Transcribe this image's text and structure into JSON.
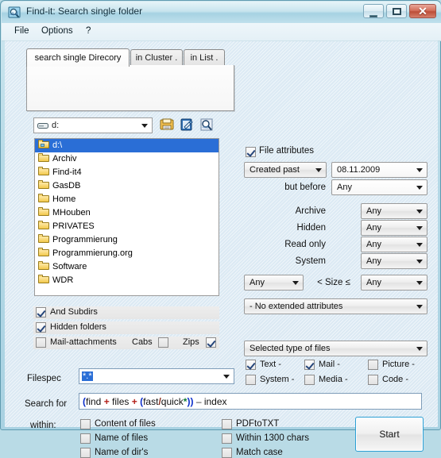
{
  "window": {
    "title": "Find-it: Search single folder",
    "icon": "app-icon",
    "buttons": {
      "minimize": "—",
      "maximize": "□",
      "close": "✕"
    }
  },
  "menu": {
    "file": "File",
    "options": "Options",
    "help": "?"
  },
  "tabs": [
    {
      "label": "search single Direcory",
      "active": true
    },
    {
      "label": "in Cluster .",
      "active": false
    },
    {
      "label": "in List .",
      "active": false
    }
  ],
  "drive": {
    "value": "d:",
    "icon": "drive-icon"
  },
  "toolbar": {
    "save": "save-icon",
    "edit": "edit-icon",
    "find": "find-icon"
  },
  "tree": {
    "items": [
      {
        "label": "d:\\",
        "selected": true,
        "open": true
      },
      {
        "label": "Archiv",
        "selected": false,
        "open": false
      },
      {
        "label": "Find-it4",
        "selected": false,
        "open": false
      },
      {
        "label": "GasDB",
        "selected": false,
        "open": false
      },
      {
        "label": "Home",
        "selected": false,
        "open": false
      },
      {
        "label": "MHouben",
        "selected": false,
        "open": false
      },
      {
        "label": "PRIVATES",
        "selected": false,
        "open": false
      },
      {
        "label": "Programmierung",
        "selected": false,
        "open": false
      },
      {
        "label": "Programmierung.org",
        "selected": false,
        "open": false
      },
      {
        "label": "Software",
        "selected": false,
        "open": false
      },
      {
        "label": "WDR",
        "selected": false,
        "open": false
      }
    ]
  },
  "options": {
    "and_subdirs": {
      "label": "And Subdirs",
      "checked": true
    },
    "hidden_folders": {
      "label": "Hidden folders",
      "checked": true
    },
    "mail_attachments": {
      "label": "Mail-attachments",
      "checked": false
    },
    "cabs": {
      "label": "Cabs",
      "checked": false
    },
    "zips": {
      "label": "Zips",
      "checked": true
    }
  },
  "filespec": {
    "label": "Filespec",
    "value": "*.*"
  },
  "search": {
    "label": "Search for",
    "value": "(find + files + (fast /quick*)) - index",
    "tokens": [
      {
        "t": "(",
        "c": "paren"
      },
      {
        "t": "find",
        "c": "word"
      },
      {
        "t": " ",
        "c": "word"
      },
      {
        "t": "+",
        "c": "plus"
      },
      {
        "t": " files ",
        "c": "word"
      },
      {
        "t": "+",
        "c": "plus"
      },
      {
        "t": " ",
        "c": "word"
      },
      {
        "t": "(",
        "c": "paren"
      },
      {
        "t": "fast",
        "c": "word"
      },
      {
        "t": "/",
        "c": "slash"
      },
      {
        "t": "quick",
        "c": "word"
      },
      {
        "t": "*",
        "c": "star"
      },
      {
        "t": "))",
        "c": "paren"
      },
      {
        "t": " ",
        "c": "word"
      },
      {
        "t": "–",
        "c": "dash"
      },
      {
        "t": " index",
        "c": "word"
      }
    ]
  },
  "within": {
    "label": "within:",
    "items": [
      {
        "label": "Content of files",
        "checked": true
      },
      {
        "label": "Name of files",
        "checked": false
      },
      {
        "label": "Name of dir's",
        "checked": false
      }
    ],
    "items_right": [
      {
        "label": "PDFtoTXT",
        "checked": false
      },
      {
        "label": "Within  1300 chars",
        "checked": false
      },
      {
        "label": "Match case",
        "checked": false
      }
    ]
  },
  "attributes": {
    "file_attributes": {
      "label": "File attributes",
      "checked": true
    },
    "created": {
      "value": "Created past"
    },
    "date": {
      "value": "08.11.2009"
    },
    "but_before_label": "but before",
    "but_before": {
      "value": "Any"
    },
    "rows": [
      {
        "label": "Archive",
        "value": "Any"
      },
      {
        "label": "Hidden",
        "value": "Any"
      },
      {
        "label": "Read only",
        "value": "Any"
      },
      {
        "label": "System",
        "value": "Any"
      }
    ],
    "size_min": {
      "value": "Any"
    },
    "size_label": "< Size ≤",
    "size_max": {
      "value": "Any"
    },
    "extended": {
      "value": "- No extended attributes"
    }
  },
  "filetypes": {
    "header": "Selected type of files",
    "items": [
      {
        "label": "Text -",
        "checked": true
      },
      {
        "label": "Mail -",
        "checked": true
      },
      {
        "label": "Picture -",
        "checked": false
      },
      {
        "label": "System -",
        "checked": false
      },
      {
        "label": "Media -",
        "checked": false
      },
      {
        "label": "Code -",
        "checked": false
      }
    ]
  },
  "start_button": {
    "label": "Start"
  },
  "colors": {
    "titlebar": "#b5d9e6",
    "client": "#dceaf4",
    "selection": "#2a6ed6",
    "accent": "#2c9fd4",
    "close": "#bb4e38"
  }
}
